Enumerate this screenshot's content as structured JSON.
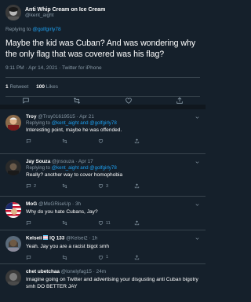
{
  "main": {
    "author_name": "Anti Whip Cream on Ice Cream",
    "author_handle": "@kent_aight",
    "replying_prefix": "Replying to",
    "replying_handle": "@golfgirly78",
    "text": "Maybe the kid was Cuban?  And was wondering why the only flag that was covered was his flag?",
    "meta": "9:11 PM · Apr 14, 2021 · Twitter for iPhone",
    "retweets_count": "1",
    "retweets_label": "Retweet",
    "likes_count": "100",
    "likes_label": "Likes"
  },
  "replies": [
    {
      "name": "Troy",
      "handle": "@Troy01619515",
      "date": "Apr 21",
      "replying_prefix": "Replying to",
      "replying_handles": "@kent_aight and @golfgirly78",
      "text": "Interesting point, maybe he was offended.",
      "reply_count": "",
      "retweet_count": "",
      "like_count": ""
    },
    {
      "name": "Jay Souza",
      "handle": "@jnsouza",
      "date": "Apr 17",
      "replying_prefix": "Replying to",
      "replying_handles": "@kent_aight and @golfgirly78",
      "text": "Really? another way to cover homophobia",
      "reply_count": "2",
      "retweet_count": "",
      "like_count": "3"
    },
    {
      "name": "MoG",
      "handle": "@MoGRiseUp",
      "date": "3h",
      "text": "Why do you hate Cubans, Jay?",
      "reply_count": "",
      "retweet_count": "",
      "like_count": "11"
    },
    {
      "name": "Kelseii",
      "badge": "IQ 133",
      "handle": "@Kelsei2",
      "date": "1h",
      "text": "Yeah. Jay you are a racist bigot smh",
      "reply_count": "",
      "retweet_count": "",
      "like_count": "1"
    },
    {
      "name": "chet ubetchaa",
      "handle": "@lonelyfag15",
      "date": "24m",
      "text": "Imagine going on Twitter and advertising your disgusting anti Cuban bigotry smh DO BETTER JAY",
      "reply_count": "",
      "retweet_count": "",
      "like_count": ""
    }
  ],
  "icons": {
    "reply": "reply-icon",
    "retweet": "retweet-icon",
    "like": "heart-icon",
    "share": "share-icon",
    "more": "chevron-down-icon"
  },
  "colors": {
    "background": "#15202b",
    "divider": "#38444d",
    "muted": "#8899a6",
    "link": "#1da1f2"
  }
}
